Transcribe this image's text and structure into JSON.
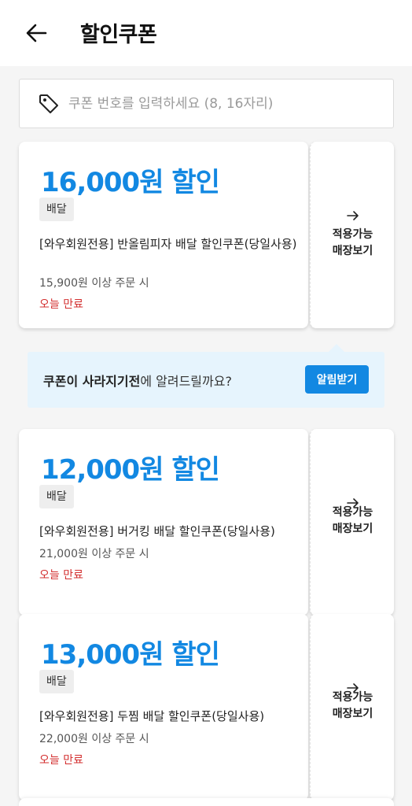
{
  "header": {
    "title": "할인쿠폰",
    "back_icon": "arrow-left-icon"
  },
  "search": {
    "placeholder": "쿠폰 번호를 입력하세요 (8, 16자리)",
    "value": "",
    "icon": "tag-icon"
  },
  "coupons": [
    {
      "amount": "16,000원 할인",
      "badge": "배달",
      "name": "[와우회원전용] 반올림피자 배달 할인쿠폰(당일사용)",
      "min_order": "15,900원 이상 주문 시",
      "expiry": "오늘 만료",
      "apply_line1": "적용가능",
      "apply_line2": "매장보기"
    },
    {
      "amount": "12,000원 할인",
      "badge": "배달",
      "name": "[와우회원전용] 버거킹 배달 할인쿠폰(당일사용)",
      "min_order": "21,000원 이상 주문 시",
      "expiry": "오늘 만료",
      "apply_line1": "적용가능",
      "apply_line2": "매장보기"
    },
    {
      "amount": "13,000원 할인",
      "badge": "배달",
      "name": "[와우회원전용] 두찜 배달 할인쿠폰(당일사용)",
      "min_order": "22,000원 이상 주문 시",
      "expiry": "오늘 만료",
      "apply_line1": "적용가능",
      "apply_line2": "매장보기"
    }
  ],
  "notify": {
    "text_bold": "쿠폰이 사라지기전",
    "text_rest": "에 알려드릴까요?",
    "button": "알림받기"
  },
  "colors": {
    "accent": "#1288e2",
    "expiry": "#d32f2f",
    "notify_bg": "#e6f4fd"
  }
}
